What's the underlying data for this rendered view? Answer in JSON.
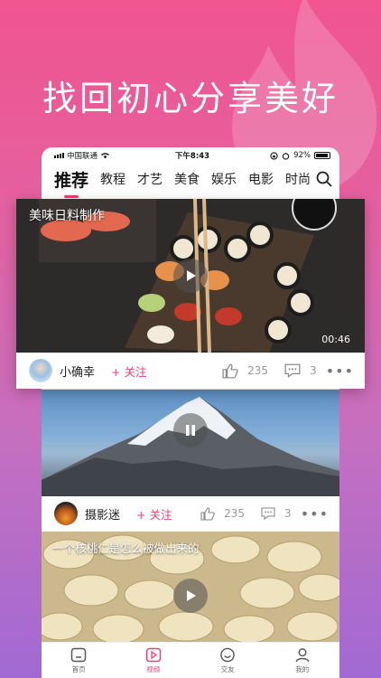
{
  "headline": "找回初心分享美好",
  "status_bar": {
    "carrier": "中国联通",
    "time": "下午8:43",
    "battery": "92%"
  },
  "tabs": [
    {
      "label": "推荐",
      "active": true
    },
    {
      "label": "教程"
    },
    {
      "label": "才艺"
    },
    {
      "label": "美食"
    },
    {
      "label": "娱乐"
    },
    {
      "label": "电影"
    },
    {
      "label": "时尚"
    }
  ],
  "cards": [
    {
      "title": "美味日料制作",
      "duration": "00:46",
      "author": "小确幸",
      "follow": "关注",
      "likes": "235",
      "comments": "3"
    },
    {
      "title": "",
      "author": "摄影迷",
      "follow": "关注",
      "likes": "235",
      "comments": "3"
    },
    {
      "title": "一个核桃仁是怎么被做出来的"
    }
  ],
  "nav": [
    {
      "label": "首页",
      "icon": "home-icon"
    },
    {
      "label": "视频",
      "icon": "video-icon",
      "active": true
    },
    {
      "label": "交友",
      "icon": "smile-icon"
    },
    {
      "label": "我的",
      "icon": "user-icon"
    }
  ],
  "colors": {
    "accent": "#ef3f74",
    "bg_top": "#f0558f",
    "bg_bottom": "#a16ad3"
  }
}
